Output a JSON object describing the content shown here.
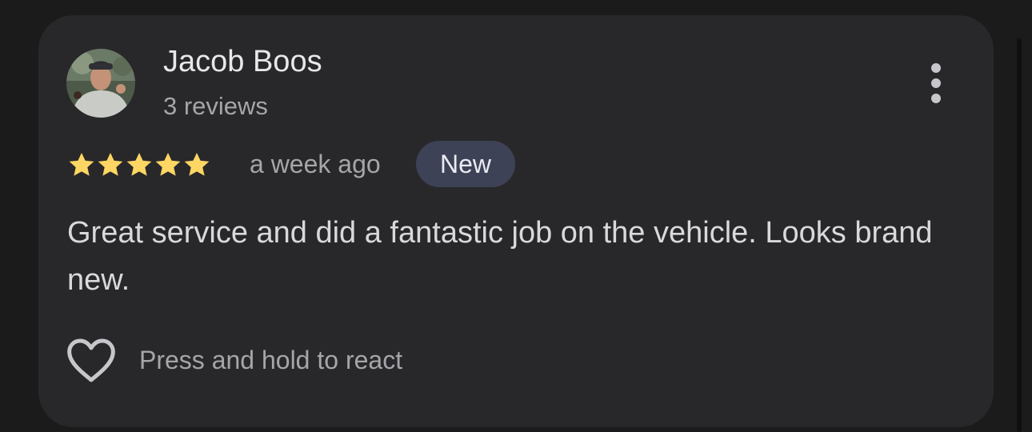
{
  "review": {
    "author_name": "Jacob Boos",
    "author_reviews": "3 reviews",
    "avatar_icon": "user-avatar-photo",
    "more_icon": "more-vertical-icon",
    "rating": 5,
    "rating_max": 5,
    "time_ago": "a week ago",
    "badge": "New",
    "text": "Great service and did a fantastic job on the vehicle. Looks brand new.",
    "react_icon": "heart-outline-icon",
    "react_hint": "Press and hold to react"
  },
  "colors": {
    "page_background": "#1b1b1c",
    "card_background": "#28282a",
    "star": "#fdd663",
    "badge_background": "#3e4256",
    "primary_text": "#e8e8ea",
    "secondary_text": "#a5a5aa"
  }
}
